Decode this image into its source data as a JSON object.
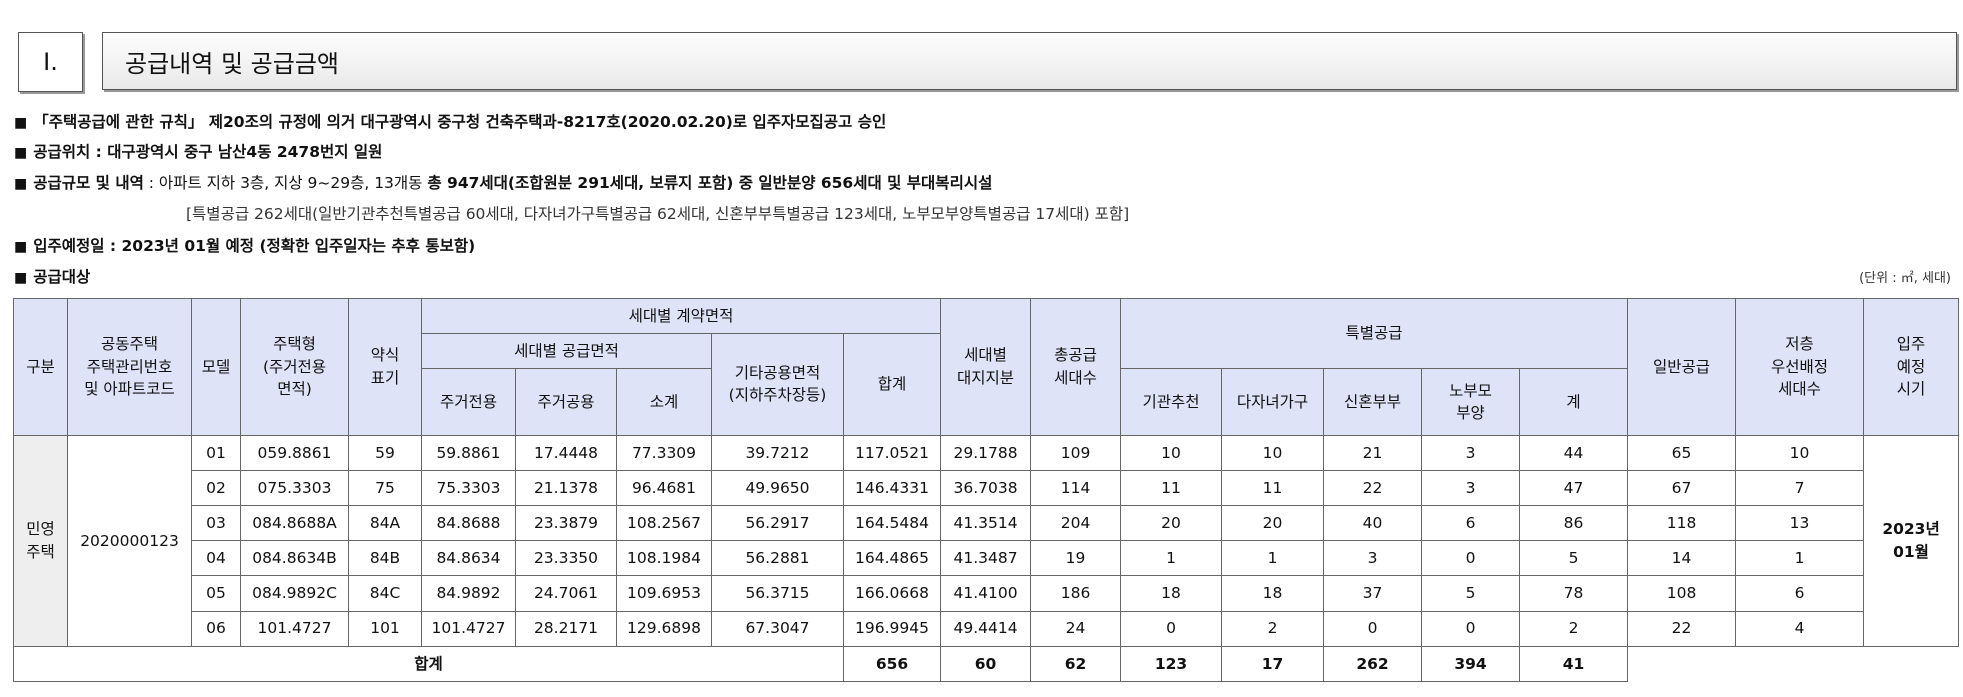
{
  "section": {
    "number": "Ⅰ.",
    "title": "공급내역 및 공급금액"
  },
  "notes": {
    "bullet": "■",
    "approval": "「주택공급에 관한 규칙」 제20조의 규정에 의거 대구광역시 중구청 건축주택과-8217호(2020.02.20)로 입주자모집공고 승인",
    "location_label": "공급위치",
    "location_value": " : 대구광역시 중구 남산4동 2478번지 일원",
    "scale_label": "공급규모 및 내역",
    "scale_plain": " : 아파트 지하 3층, 지상 9~29층, 13개동 ",
    "scale_bold": "총 947세대(조합원분 291세대, 보류지 포함) 중 일반분양 656세대 및 부대복리시설",
    "scale_special": "[특별공급 262세대(일반기관추천특별공급 60세대, 다자녀가구특별공급 62세대, 신혼부부특별공급 123세대, 노부모부양특별공급 17세대) 포함]",
    "movein": "입주예정일 : 2023년 01월 예정 (정확한 입주일자는 추후 통보함)",
    "target": "공급대상",
    "unit": "(단위 : ㎡, 세대)"
  },
  "table": {
    "headers": {
      "category": "구분",
      "code": [
        "공동주택",
        "주택관리번호",
        "및 아파트코드"
      ],
      "model": "모델",
      "housing_type": [
        "주택형",
        "(주거전용",
        "면적)"
      ],
      "short": [
        "약식",
        "표기"
      ],
      "contract_area": "세대별 계약면적",
      "supply_area": "세대별 공급면적",
      "exclusive": "주거전용",
      "common": "주거공용",
      "subtotal": "소계",
      "other_common": [
        "기타공용면적",
        "(지하주차장등)"
      ],
      "sum": "합계",
      "land_share": [
        "세대별",
        "대지지분"
      ],
      "total_units": [
        "총공급",
        "세대수"
      ],
      "special": "특별공급",
      "institution": "기관추천",
      "multi_child": "다자녀가구",
      "newlywed": "신혼부부",
      "elderly": [
        "노부모",
        "부양"
      ],
      "special_total": "계",
      "general": "일반공급",
      "low_floor": [
        "저층",
        "우선배정",
        "세대수"
      ],
      "movein": [
        "입주",
        "예정",
        "시기"
      ]
    },
    "category_value": [
      "민영",
      "주택"
    ],
    "code_value": "2020000123",
    "movein_value": [
      "2023년",
      "01월"
    ],
    "rows": [
      [
        "01",
        "059.8861",
        "59",
        "59.8861",
        "17.4448",
        "77.3309",
        "39.7212",
        "117.0521",
        "29.1788",
        "109",
        "10",
        "10",
        "21",
        "3",
        "44",
        "65",
        "10"
      ],
      [
        "02",
        "075.3303",
        "75",
        "75.3303",
        "21.1378",
        "96.4681",
        "49.9650",
        "146.4331",
        "36.7038",
        "114",
        "11",
        "11",
        "22",
        "3",
        "47",
        "67",
        "7"
      ],
      [
        "03",
        "084.8688A",
        "84A",
        "84.8688",
        "23.3879",
        "108.2567",
        "56.2917",
        "164.5484",
        "41.3514",
        "204",
        "20",
        "20",
        "40",
        "6",
        "86",
        "118",
        "13"
      ],
      [
        "04",
        "084.8634B",
        "84B",
        "84.8634",
        "23.3350",
        "108.1984",
        "56.2881",
        "164.4865",
        "41.3487",
        "19",
        "1",
        "1",
        "3",
        "0",
        "5",
        "14",
        "1"
      ],
      [
        "05",
        "084.9892C",
        "84C",
        "84.9892",
        "24.7061",
        "109.6953",
        "56.3715",
        "166.0668",
        "41.4100",
        "186",
        "18",
        "18",
        "37",
        "5",
        "78",
        "108",
        "6"
      ],
      [
        "06",
        "101.4727",
        "101",
        "101.4727",
        "28.2171",
        "129.6898",
        "67.3047",
        "196.9945",
        "49.4414",
        "24",
        "0",
        "2",
        "0",
        "0",
        "2",
        "22",
        "4"
      ]
    ],
    "total": {
      "label": "합계",
      "values": [
        "656",
        "60",
        "62",
        "123",
        "17",
        "262",
        "394",
        "41"
      ]
    }
  }
}
